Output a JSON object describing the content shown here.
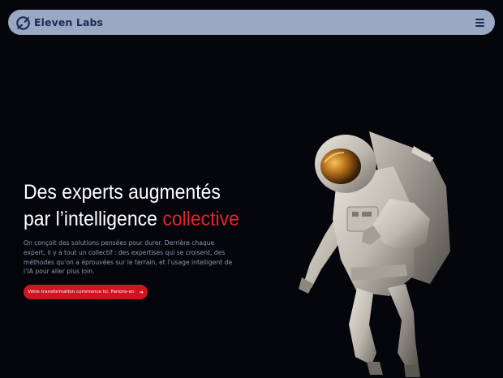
{
  "nav": {
    "brand_name": "Eleven Labs",
    "logo_icon": "rocket-planet-logo",
    "menu_icon": "hamburger-icon"
  },
  "hero": {
    "title_line1": "Des experts augmentés",
    "title_line2_start": "par l’intelligence ",
    "title_accent": "collective",
    "description": "On conçoit des solutions pensées pour durer. Derrière chaque expert, il y a tout un collectif : des expertises qui se croisent, des méthodes qu’on a éprouvées sur le terrain, et l’usage intelligent de l’IA pour aller plus loin.",
    "cta_label": "Votre transformation commence ici. Parlons-en",
    "cta_icon": "arrow-right-icon"
  },
  "colors": {
    "background": "#05060c",
    "navbar": "#9aa8c3",
    "brand": "#1a2c55",
    "accent": "#e5222d",
    "button": "#d01422",
    "body_text": "#8e94ab"
  }
}
